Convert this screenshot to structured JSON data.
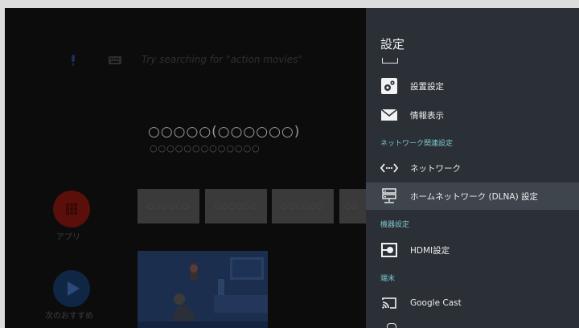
{
  "home": {
    "search_hint": "Try searching for \"action movies\"",
    "featured_title": "○○○○○(○○○○○○)",
    "featured_subtitle": "○○○○○○○○○○○○○",
    "apps_label": "アプリ",
    "next_label": "次のおすすめ",
    "tiles": [
      "○○○○○○",
      "○○○○○○",
      "○○○○○○",
      "○○"
    ]
  },
  "settings": {
    "title": "設定",
    "items": [
      {
        "label": "設置設定",
        "icon": "gear-pair-icon"
      },
      {
        "label": "情報表示",
        "icon": "envelope-icon"
      },
      {
        "label": "ネットワーク",
        "icon": "network-arrows-icon"
      },
      {
        "label": "ホームネットワーク (DLNA) 設定",
        "icon": "server-icon"
      },
      {
        "label": "HDMI設定",
        "icon": "hdmi-icon"
      },
      {
        "label": "Google Cast",
        "icon": "cast-icon"
      }
    ],
    "sections": {
      "network": "ネットワーク関連設定",
      "device": "機器設定",
      "terminal": "端末"
    }
  },
  "colors": {
    "panel_bg": "#2b3037",
    "selected_row": "#3f454d",
    "section_text": "#7ec4c9",
    "apps_red": "#5a0f0a",
    "next_blue": "#0f2745"
  }
}
